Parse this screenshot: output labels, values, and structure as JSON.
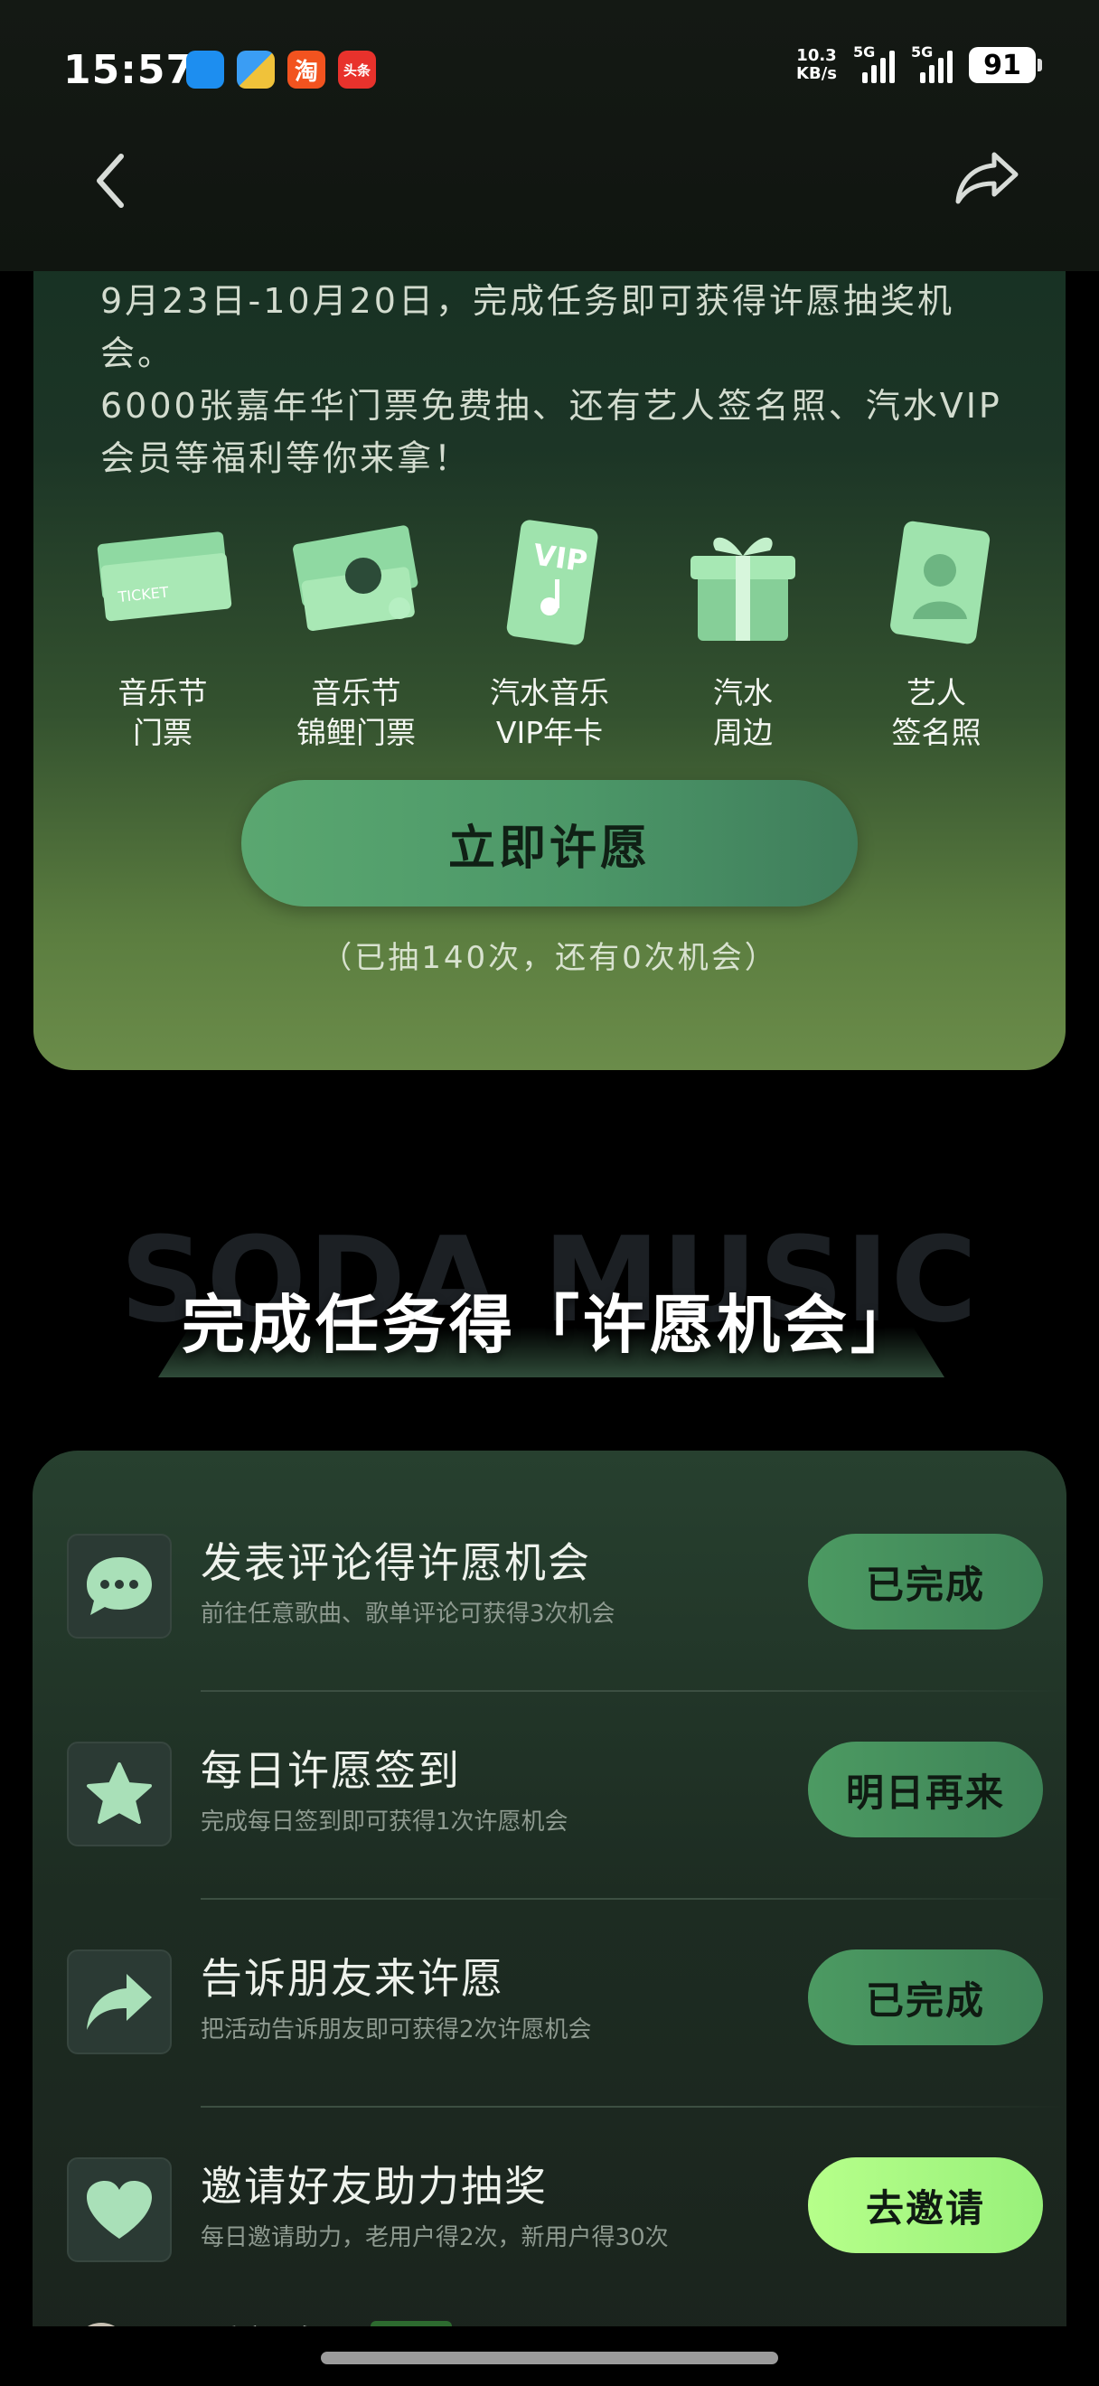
{
  "status_bar": {
    "time": "15:57",
    "app_icons": [
      {
        "name": "app-blue-icon",
        "text": "",
        "color": "#1d8ef0"
      },
      {
        "name": "app-files-icon",
        "text": "",
        "color": "#3a9df4"
      },
      {
        "name": "taobao-icon",
        "text": "淘",
        "color": "#f2531f"
      },
      {
        "name": "toutiao-icon",
        "text": "头条",
        "color": "#e8322c"
      }
    ],
    "net_speed_value": "10.3",
    "net_speed_unit": "KB/s",
    "signal1_label": "5G",
    "signal2_label": "5G",
    "battery": "91"
  },
  "intro": {
    "line1": "9月23日-10月20日，完成任务即可获得许愿抽奖机会。",
    "line2": "6000张嘉年华门票免费抽、还有艺人签名照、汽水VIP会员等福利等你来拿！"
  },
  "prizes": [
    {
      "line1": "音乐节",
      "line2": "门票",
      "icon": "ticket-icon"
    },
    {
      "line1": "音乐节",
      "line2": "锦鲤门票",
      "icon": "koi-ticket-icon"
    },
    {
      "line1": "汽水音乐",
      "line2": "VIP年卡",
      "icon": "vip-card-icon"
    },
    {
      "line1": "汽水",
      "line2": "周边",
      "icon": "gift-box-icon"
    },
    {
      "line1": "艺人",
      "line2": "签名照",
      "icon": "signed-photo-icon"
    }
  ],
  "wish_button": "立即许愿",
  "draw_info": "（已抽140次，还有0次机会）",
  "section": {
    "bg_word": "SODA MUSIC",
    "title": "完成任务得「许愿机会」"
  },
  "tasks": [
    {
      "icon": "comment-icon",
      "title": "发表评论得许愿机会",
      "desc": "前往任意歌曲、歌单评论可获得3次机会",
      "action": "已完成"
    },
    {
      "icon": "star-icon",
      "title": "每日许愿签到",
      "desc": "完成每日签到即可获得1次许愿机会",
      "action": "明日再来"
    },
    {
      "icon": "share-icon",
      "title": "告诉朋友来许愿",
      "desc": "把活动告诉朋友即可获得2次许愿机会",
      "action": "已完成"
    },
    {
      "icon": "heart-icon",
      "title": "邀请好友助力抽奖",
      "desc": "每日邀请助力，老用户得2次，新用户得30次",
      "action": "去邀请"
    }
  ],
  "partial_row_text": "看望有理"
}
